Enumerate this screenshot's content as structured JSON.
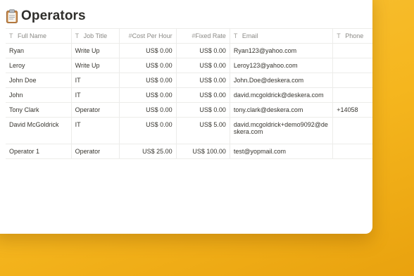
{
  "page": {
    "title": "Operators",
    "title_icon": "clipboard-icon"
  },
  "columns": [
    {
      "label": "Full Name",
      "icon": "text-type-icon",
      "glyph": "T",
      "align": "left"
    },
    {
      "label": "Job Title",
      "icon": "text-type-icon",
      "glyph": "T",
      "align": "left"
    },
    {
      "label": "Cost Per Hour",
      "icon": "number-type-icon",
      "glyph": "#",
      "align": "right"
    },
    {
      "label": "Fixed Rate",
      "icon": "number-type-icon",
      "glyph": "#",
      "align": "right"
    },
    {
      "label": "Email",
      "icon": "text-type-icon",
      "glyph": "T",
      "align": "left"
    },
    {
      "label": "Phone",
      "icon": "text-type-icon",
      "glyph": "T",
      "align": "left"
    }
  ],
  "rows": [
    {
      "full_name": "Ryan",
      "job_title": "Write Up",
      "cost_per_hour": "US$ 0.00",
      "fixed_rate": "US$ 0.00",
      "email": "Ryan123@yahoo.com",
      "phone": ""
    },
    {
      "full_name": "Leroy",
      "job_title": "Write Up",
      "cost_per_hour": "US$ 0.00",
      "fixed_rate": "US$ 0.00",
      "email": "Leroy123@yahoo.com",
      "phone": ""
    },
    {
      "full_name": "John Doe",
      "job_title": "IT",
      "cost_per_hour": "US$ 0.00",
      "fixed_rate": "US$ 0.00",
      "email": "John.Doe@deskera.com",
      "phone": ""
    },
    {
      "full_name": "John",
      "job_title": "IT",
      "cost_per_hour": "US$ 0.00",
      "fixed_rate": "US$ 0.00",
      "email": "david.mcgoldrick@deskera.com",
      "phone": ""
    },
    {
      "full_name": "Tony Clark",
      "job_title": "Operator",
      "cost_per_hour": "US$ 0.00",
      "fixed_rate": "US$ 0.00",
      "email": "tony.clark@deskera.com",
      "phone": "+14058"
    },
    {
      "full_name": "David McGoldrick",
      "job_title": "IT",
      "cost_per_hour": "US$ 0.00",
      "fixed_rate": "US$ 5.00",
      "email": "david.mcgoldrick+demo9092@deskera.com",
      "phone": ""
    },
    {
      "full_name": "Operator 1",
      "job_title": "Operator",
      "cost_per_hour": "US$ 25.00",
      "fixed_rate": "US$ 100.00",
      "email": "test@yopmail.com",
      "phone": ""
    }
  ]
}
